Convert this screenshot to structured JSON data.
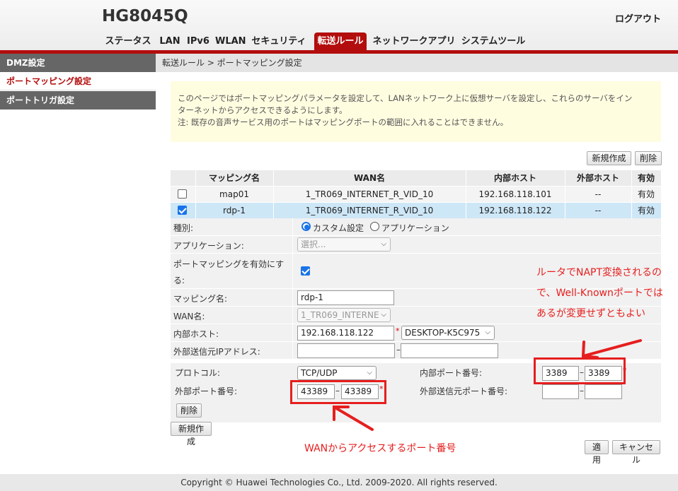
{
  "header": {
    "model": "HG8045Q",
    "logout": "ログアウト"
  },
  "menu": {
    "tabs": [
      "ステータス",
      "LAN",
      "IPv6",
      "WLAN",
      "セキュリティ",
      "転送ルール",
      "ネットワークアプリ",
      "システムツール"
    ],
    "active": "転送ルール"
  },
  "sidebar": {
    "items": [
      "DMZ設定",
      "ポートマッピング設定",
      "ポートトリガ設定"
    ],
    "active": "ポートマッピング設定"
  },
  "breadcrumb": "転送ルール > ポートマッピング設定",
  "notice": {
    "line1": "このページではポートマッピングパラメータを設定して、LANネットワーク上に仮想サーバを設定し、これらのサーバをイン",
    "line2": "ターネットからアクセスできるようにします。",
    "line3": "注: 既存の音声サービス用のポートはマッピングポートの範囲に入れることはできません。"
  },
  "buttons": {
    "new": "新規作成",
    "delete": "削除",
    "apply": "適用",
    "cancel": "キャンセル"
  },
  "table": {
    "headers": [
      "",
      "マッピング名",
      "WAN名",
      "内部ホスト",
      "外部ホスト",
      "有効"
    ],
    "rows": [
      {
        "checked": false,
        "name": "map01",
        "wan": "1_TR069_INTERNET_R_VID_10",
        "host": "192.168.118.101",
        "ext": "--",
        "enabled": "有効"
      },
      {
        "checked": true,
        "name": "rdp-1",
        "wan": "1_TR069_INTERNET_R_VID_10",
        "host": "192.168.118.122",
        "ext": "--",
        "enabled": "有効"
      }
    ]
  },
  "form": {
    "type_label": "種別:",
    "type_custom": "カスタム設定",
    "type_app": "アプリケーション",
    "app_label": "アプリケーション:",
    "app_placeholder": "選択...",
    "enable_label_1": "ポートマッピングを有効にす",
    "enable_label_2": "る:",
    "enable_checked": true,
    "name_label": "マッピング名:",
    "name_value": "rdp-1",
    "wan_label": "WAN名:",
    "wan_value": "1_TR069_INTERNE",
    "host_label": "内部ホスト:",
    "host_value": "192.168.118.122",
    "host_device": "DESKTOP-K5C975",
    "ext_ip_label": "外部送信元IPアドレス:",
    "ext_ip_start": "",
    "ext_ip_end": ""
  },
  "ports": {
    "protocol_label": "プロトコル:",
    "protocol_value": "TCP/UDP",
    "internal_label": "内部ポート番号:",
    "internal_start": "3389",
    "internal_end": "3389",
    "external_label": "外部ポート番号:",
    "external_start": "43389",
    "external_end": "43389",
    "ext_src_label": "外部送信元ポート番号:",
    "ext_src_start": "",
    "ext_src_end": "",
    "delete": "削除"
  },
  "annotations": {
    "right_1": "ルータでNAPT変換されるの",
    "right_2": "で、Well-Knownポートでは",
    "right_3": "あるが変更せずともよい",
    "bottom": "WANからアクセスするポート番号",
    "color": "#e61e1e"
  },
  "footer": "Copyright © Huawei Technologies Co., Ltd. 2009-2020. All rights reserved.",
  "colors": {
    "brand_red": "#b30d0d",
    "selected_row": "#cde7f7",
    "notice_bg": "#fffde0",
    "accent_blue": "#1a73e8"
  }
}
